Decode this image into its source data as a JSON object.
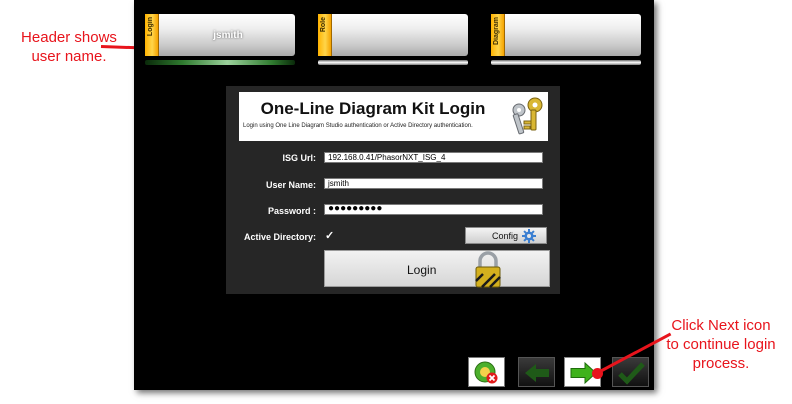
{
  "annotations": {
    "header_note": [
      "Header shows",
      "user name."
    ],
    "next_note": [
      "Click Next icon",
      "to continue login",
      "process."
    ]
  },
  "tabs": [
    {
      "label": "Login",
      "value": "jsmith"
    },
    {
      "label": "Role",
      "value": ""
    },
    {
      "label": "Diagram",
      "value": ""
    }
  ],
  "login": {
    "title": "One-Line Diagram Kit Login",
    "subtitle": "Login using One Line Diagram Studio authentication or Active Directory authentication.",
    "isg_url_label": "ISG Url:",
    "isg_url_value": "192.168.0.41/PhasorNXT_ISG_4",
    "username_label": "User Name:",
    "username_value": "jsmith",
    "password_label": "Password :",
    "password_value": "●●●●●●●●●",
    "active_directory_label": "Active Directory:",
    "active_directory_checked": "✓",
    "config_label": "Config",
    "login_label": "Login"
  },
  "icons": {
    "keys": "keys-icon",
    "gear": "gear-icon",
    "padlock": "padlock-icon",
    "cancel": "cancel-icon",
    "back": "arrow-left-icon",
    "next": "arrow-right-icon",
    "done": "checkmark-icon"
  },
  "colors": {
    "annotation": "#e8141c",
    "tab_tag": "#ffc21a",
    "next_arrow": "#3fb21c",
    "disabled_nav": "#1f5a18"
  }
}
